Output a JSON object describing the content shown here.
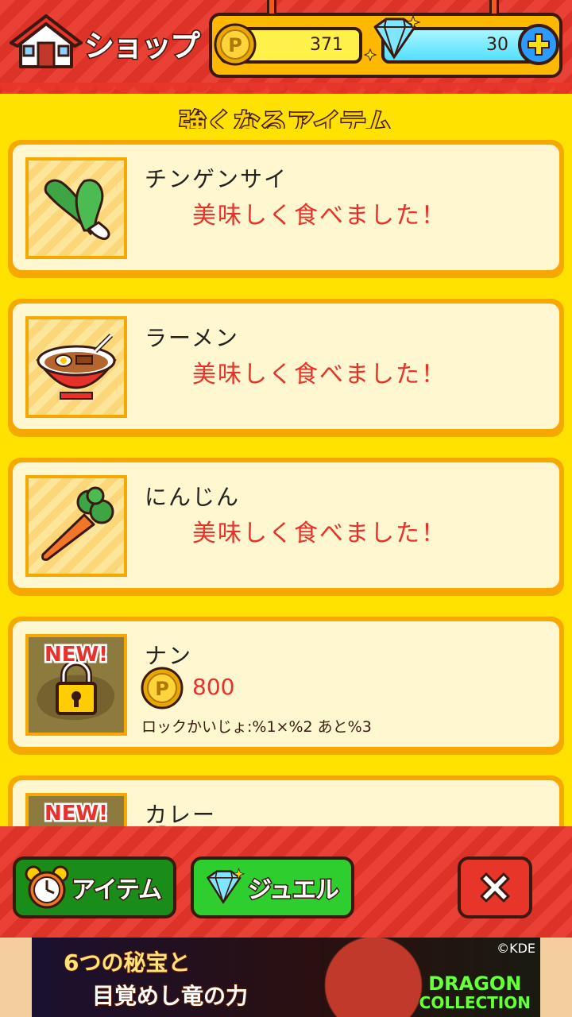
{
  "header": {
    "title": "ショップ",
    "coins": "371",
    "gems": "30"
  },
  "section_title": "強くなるアイテム",
  "items": [
    {
      "name": "チンゲンサイ",
      "status": "美味しく食べました！"
    },
    {
      "name": "ラーメン",
      "status": "美味しく食べました！"
    },
    {
      "name": "にんじん",
      "status": "美味しく食べました！"
    },
    {
      "name": "ナン",
      "badge": "NEW!",
      "price": "800",
      "unlock": "ロックかいじょ:%1×%2 あと%3"
    },
    {
      "name": "カレー",
      "badge": "NEW!"
    }
  ],
  "bottom": {
    "tab_items": "アイテム",
    "tab_jewel": "ジュエル"
  },
  "ad": {
    "line1": "6つの秘宝と",
    "line2": "目覚めし竜の力",
    "copyright": "©KDE",
    "brand1": "DRAGON",
    "brand2": "COLLECTION"
  },
  "colors": {
    "background": "#ffe200",
    "header": "#e8352a",
    "card_border": "#f6a800",
    "status_red": "#e8312a",
    "tab_green": "#2fce2f"
  }
}
